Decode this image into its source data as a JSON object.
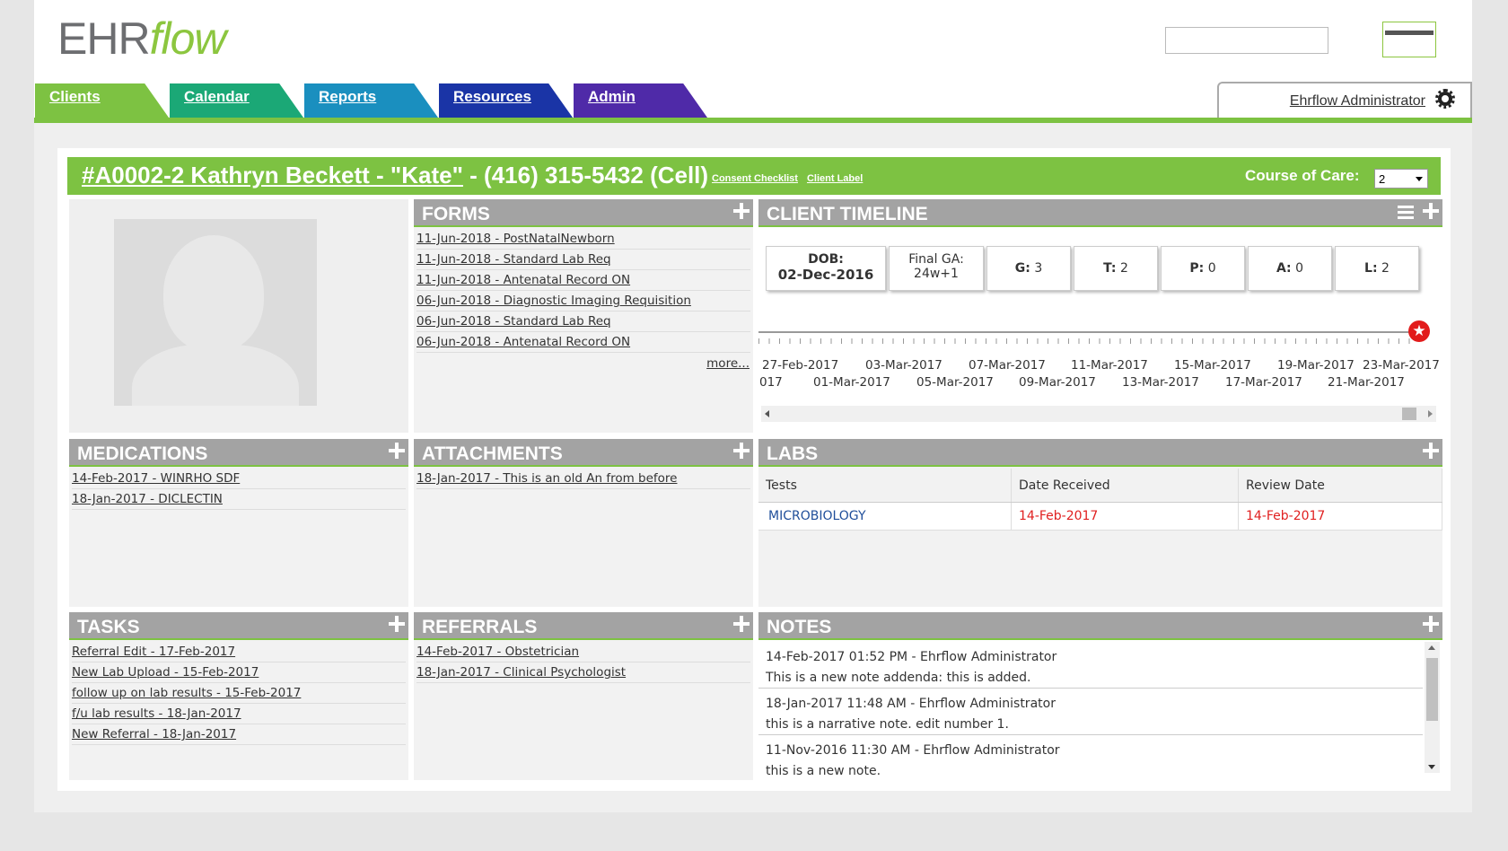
{
  "logo": {
    "part1": "EHR",
    "part2": "flow"
  },
  "nav": {
    "tabs": [
      {
        "label": "Clients",
        "color": "#7dc242"
      },
      {
        "label": "Calendar",
        "color": "#1ba876"
      },
      {
        "label": "Reports",
        "color": "#1a8fbf"
      },
      {
        "label": "Resources",
        "color": "#1a34a6"
      },
      {
        "label": "Admin",
        "color": "#4f2aa8"
      }
    ]
  },
  "user": {
    "name": "Ehrflow Administrator"
  },
  "client": {
    "id_name": "#A0002-2 Kathryn Beckett - \"Kate\"",
    "phone": " - (416) 315-5432 (Cell)",
    "links": [
      "Consent Checklist",
      "Client Label"
    ],
    "course_of_care_label": "Course of Care:",
    "course_of_care_value": "2"
  },
  "forms": {
    "title": "FORMS",
    "items": [
      "11-Jun-2018 - PostNatalNewborn",
      "11-Jun-2018 - Standard Lab Req",
      "11-Jun-2018 - Antenatal Record ON",
      "06-Jun-2018 - Diagnostic Imaging Requisition",
      "06-Jun-2018 - Standard Lab Req",
      "06-Jun-2018 - Antenatal Record ON"
    ],
    "more": "more..."
  },
  "timeline": {
    "title": "CLIENT TIMELINE",
    "boxes": [
      {
        "label": "DOB:",
        "value": "02-Dec-2016"
      },
      {
        "label": "Final GA:",
        "value": "24w+1"
      },
      {
        "label": "G:",
        "value": "3"
      },
      {
        "label": "T:",
        "value": "2"
      },
      {
        "label": "P:",
        "value": "0"
      },
      {
        "label": "A:",
        "value": "0"
      },
      {
        "label": "L:",
        "value": "2"
      }
    ],
    "dates_top": [
      "27-Feb-2017",
      "03-Mar-2017",
      "07-Mar-2017",
      "11-Mar-2017",
      "15-Mar-2017",
      "19-Mar-2017",
      "23-Mar-2017"
    ],
    "dates_bottom": [
      "017",
      "01-Mar-2017",
      "05-Mar-2017",
      "09-Mar-2017",
      "13-Mar-2017",
      "17-Mar-2017",
      "21-Mar-2017"
    ]
  },
  "medications": {
    "title": "MEDICATIONS",
    "items": [
      "14-Feb-2017 - WINRHO SDF",
      "18-Jan-2017 - DICLECTIN"
    ]
  },
  "attachments": {
    "title": "ATTACHMENTS",
    "items": [
      "18-Jan-2017 - This is an old An from before"
    ]
  },
  "labs": {
    "title": "LABS",
    "columns": [
      "Tests",
      "Date Received",
      "Review Date"
    ],
    "rows": [
      {
        "test": "MICROBIOLOGY",
        "received": "14-Feb-2017",
        "review": "14-Feb-2017"
      }
    ]
  },
  "tasks": {
    "title": "TASKS",
    "items": [
      "Referral Edit - 17-Feb-2017",
      "New Lab Upload - 15-Feb-2017",
      "follow up on lab results - 15-Feb-2017",
      "f/u lab results - 18-Jan-2017",
      "New Referral - 18-Jan-2017"
    ]
  },
  "referrals": {
    "title": "REFERRALS",
    "items": [
      "14-Feb-2017 - Obstetrician",
      "18-Jan-2017 - Clinical Psychologist"
    ]
  },
  "notes": {
    "title": "NOTES",
    "items": [
      {
        "header": "14-Feb-2017 01:52 PM - Ehrflow Administrator",
        "body": "This is a new note addenda: this is added."
      },
      {
        "header": "18-Jan-2017 11:48 AM - Ehrflow Administrator",
        "body": "this is a narrative note. edit number 1."
      },
      {
        "header": "11-Nov-2016 11:30 AM - Ehrflow Administrator",
        "body": "this is a new note."
      }
    ]
  }
}
